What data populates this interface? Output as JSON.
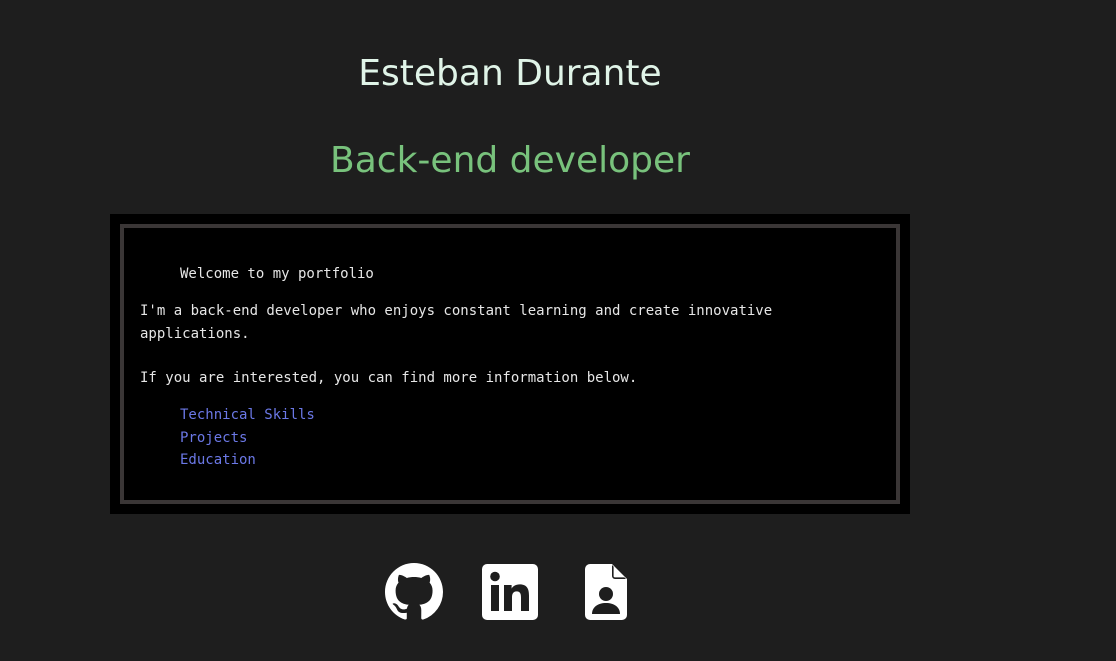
{
  "header": {
    "name": "Esteban Durante",
    "role": "Back-end developer"
  },
  "terminal": {
    "welcome": "Welcome to my portfolio",
    "intro": "I'm a back-end developer who enjoys constant learning and create innovative applications.",
    "more": "If you are interested, you can find more information below.",
    "links": [
      {
        "label": "Technical Skills"
      },
      {
        "label": "Projects"
      },
      {
        "label": "Education"
      }
    ]
  },
  "social": [
    {
      "icon": "github-icon"
    },
    {
      "icon": "linkedin-icon"
    },
    {
      "icon": "resume-icon"
    }
  ],
  "colors": {
    "background": "#1e1e1e",
    "name": "#e0f4e8",
    "role": "#78c27c",
    "terminal_bg": "#000000",
    "terminal_border": "#3a3636",
    "terminal_text": "#e6e6e6",
    "link": "#6b78e6",
    "icon": "#ffffff"
  }
}
